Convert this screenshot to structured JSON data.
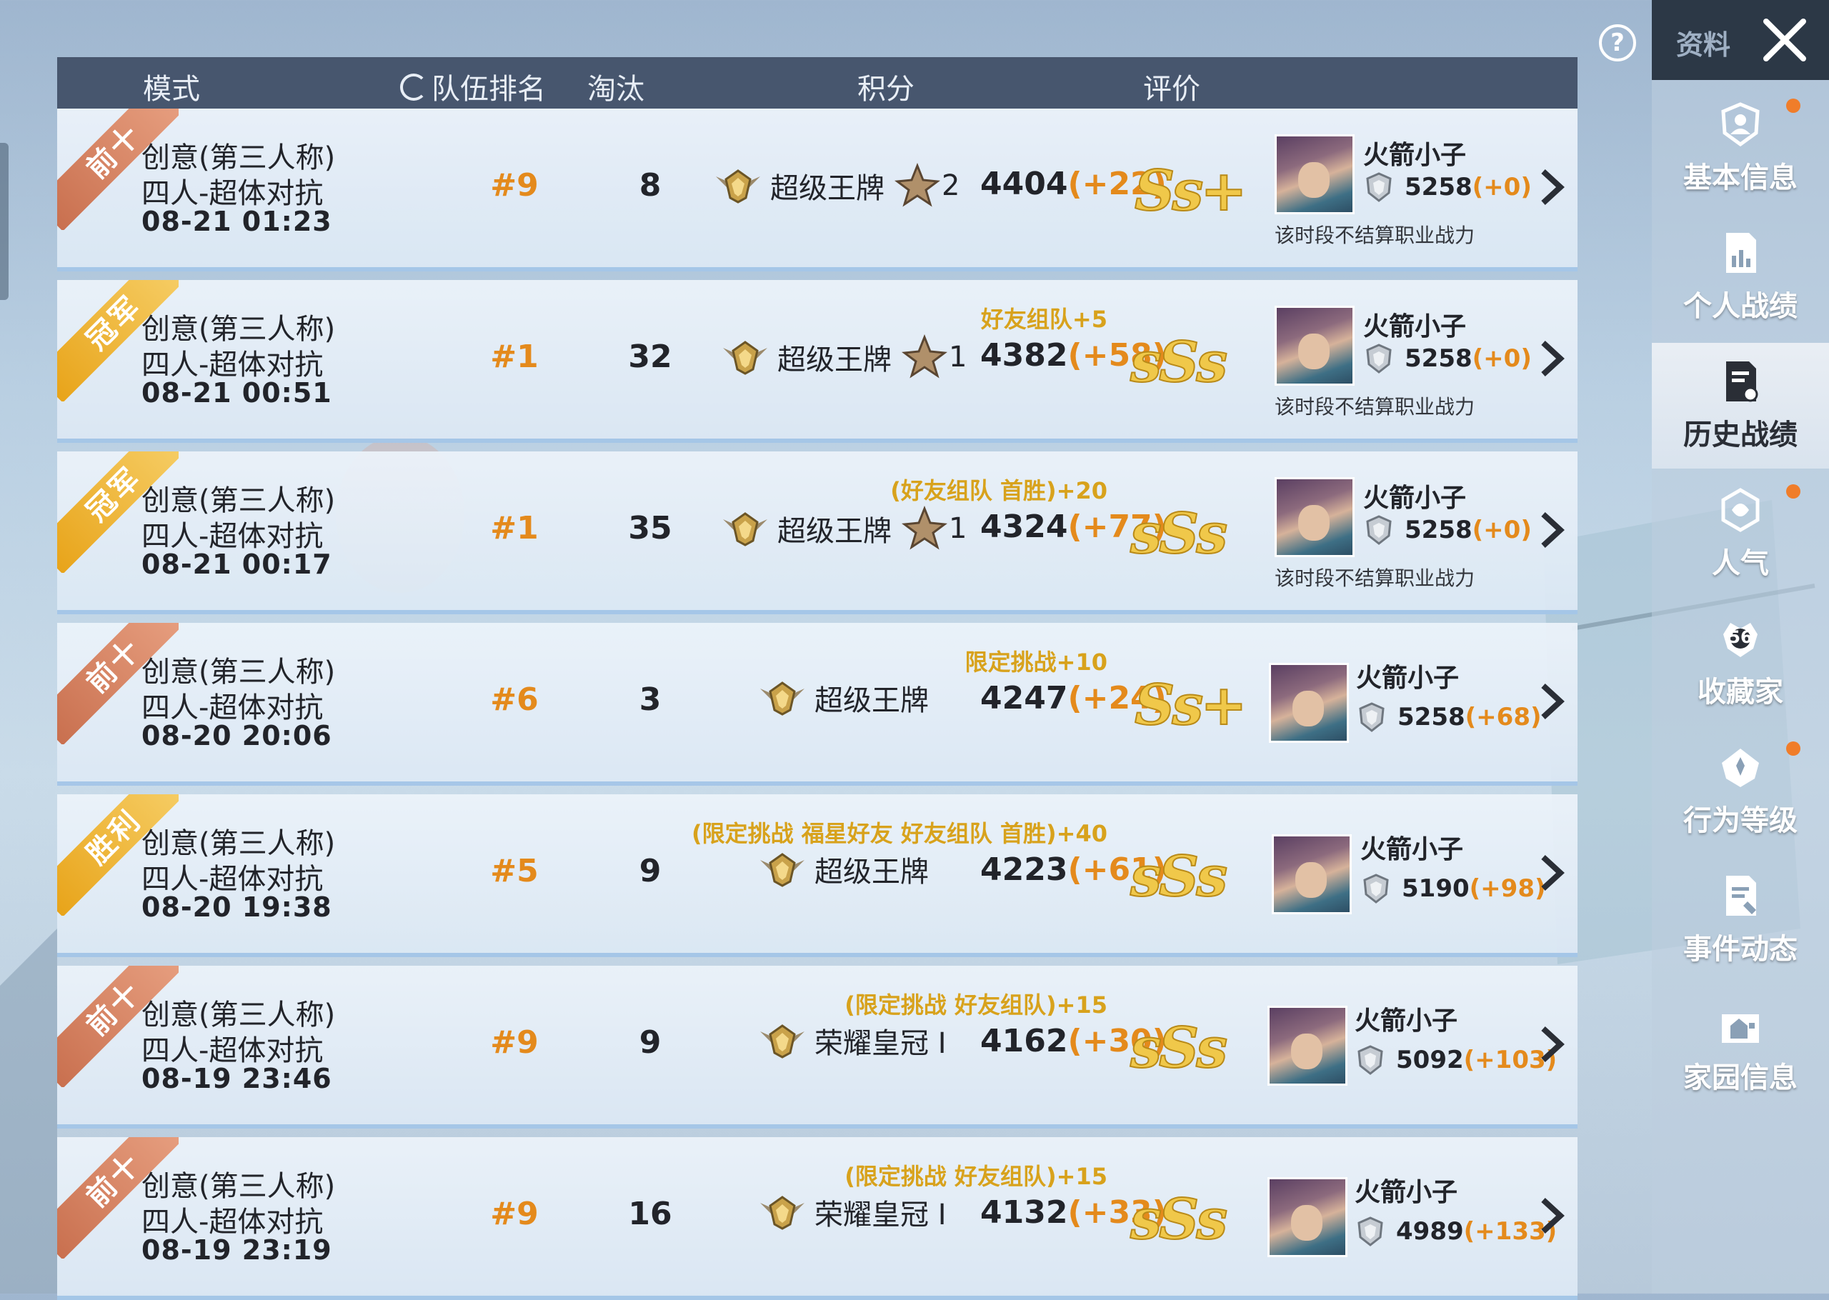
{
  "header": {
    "mode": "模式",
    "team_rank": "队伍排名",
    "eliminations": "淘汰",
    "score": "积分",
    "rating": "评价"
  },
  "help_label": "?",
  "sidebar": {
    "title": "资料",
    "items": [
      {
        "label": "基本信息",
        "icon": "person-shield-icon",
        "dot": true
      },
      {
        "label": "个人战绩",
        "icon": "chart-doc-icon",
        "dot": false
      },
      {
        "label": "历史战绩",
        "icon": "history-doc-icon",
        "dot": false,
        "active": true
      },
      {
        "label": "人气",
        "icon": "popularity-icon",
        "dot": true
      },
      {
        "label": "收藏家",
        "icon": "collector-badge-icon",
        "badge": "56",
        "dot": false
      },
      {
        "label": "行为等级",
        "icon": "behavior-badge-icon",
        "dot": true
      },
      {
        "label": "事件动态",
        "icon": "event-doc-icon",
        "dot": false
      },
      {
        "label": "家园信息",
        "icon": "home-icon",
        "dot": false
      }
    ]
  },
  "matches": [
    {
      "ribbon": "前十",
      "ribbon_style": "top10",
      "mode": "创意(第三人称)",
      "submode": "四人-超体对抗",
      "time": "08-21 01:23",
      "rank": "#9",
      "eliminations": "8",
      "bonus": "",
      "tier": "超级王牌",
      "stars": "2",
      "score": "4404",
      "score_delta": "(+22)",
      "rating": "Ss+",
      "player": "火箭小子",
      "power": "5258",
      "power_delta": "(+0)",
      "note": "该时段不结算职业战力"
    },
    {
      "ribbon": "冠军",
      "ribbon_style": "gold",
      "mode": "创意(第三人称)",
      "submode": "四人-超体对抗",
      "time": "08-21 00:51",
      "rank": "#1",
      "eliminations": "32",
      "bonus": "好友组队+5",
      "tier": "超级王牌",
      "stars": "1",
      "score": "4382",
      "score_delta": "(+58)",
      "rating": "sSs",
      "player": "火箭小子",
      "power": "5258",
      "power_delta": "(+0)",
      "note": "该时段不结算职业战力"
    },
    {
      "ribbon": "冠军",
      "ribbon_style": "gold",
      "mode": "创意(第三人称)",
      "submode": "四人-超体对抗",
      "time": "08-21 00:17",
      "rank": "#1",
      "eliminations": "35",
      "bonus": "(好友组队 首胜)+20",
      "tier": "超级王牌",
      "stars": "1",
      "score": "4324",
      "score_delta": "(+77)",
      "rating": "sSs",
      "player": "火箭小子",
      "power": "5258",
      "power_delta": "(+0)",
      "note": "该时段不结算职业战力"
    },
    {
      "ribbon": "前十",
      "ribbon_style": "top10",
      "mode": "创意(第三人称)",
      "submode": "四人-超体对抗",
      "time": "08-20 20:06",
      "rank": "#6",
      "eliminations": "3",
      "bonus": "限定挑战+10",
      "tier": "超级王牌",
      "stars": "",
      "score": "4247",
      "score_delta": "(+24)",
      "rating": "Ss+",
      "player": "火箭小子",
      "power": "5258",
      "power_delta": "(+68)",
      "note": ""
    },
    {
      "ribbon": "胜利",
      "ribbon_style": "gold",
      "mode": "创意(第三人称)",
      "submode": "四人-超体对抗",
      "time": "08-20 19:38",
      "rank": "#5",
      "eliminations": "9",
      "bonus": "(限定挑战 福星好友 好友组队 首胜)+40",
      "tier": "超级王牌",
      "stars": "",
      "score": "4223",
      "score_delta": "(+61)",
      "rating": "sSs",
      "player": "火箭小子",
      "power": "5190",
      "power_delta": "(+98)",
      "note": ""
    },
    {
      "ribbon": "前十",
      "ribbon_style": "top10",
      "mode": "创意(第三人称)",
      "submode": "四人-超体对抗",
      "time": "08-19 23:46",
      "rank": "#9",
      "eliminations": "9",
      "bonus": "(限定挑战 好友组队)+15",
      "tier": "荣耀皇冠 I",
      "stars": "",
      "score": "4162",
      "score_delta": "(+30)",
      "rating": "sSs",
      "player": "火箭小子",
      "power": "5092",
      "power_delta": "(+103)",
      "note": ""
    },
    {
      "ribbon": "前十",
      "ribbon_style": "top10",
      "mode": "创意(第三人称)",
      "submode": "四人-超体对抗",
      "time": "08-19 23:19",
      "rank": "#9",
      "eliminations": "16",
      "bonus": "(限定挑战 好友组队)+15",
      "tier": "荣耀皇冠 I",
      "stars": "",
      "score": "4132",
      "score_delta": "(+33)",
      "rating": "sSs",
      "player": "火箭小子",
      "power": "4989",
      "power_delta": "(+133)",
      "note": ""
    }
  ],
  "colors": {
    "accent_orange": "#e48a1c",
    "bonus_gold": "#d8a21c",
    "header_bg": "#3a4860",
    "sidebar_dark": "#2c3846",
    "notify_dot": "#f07d2a"
  }
}
